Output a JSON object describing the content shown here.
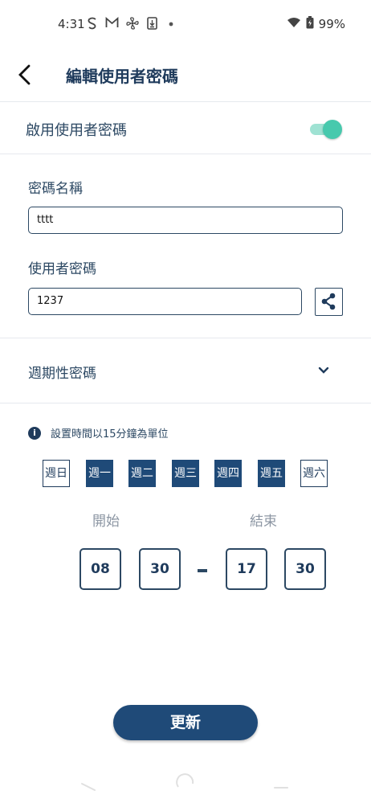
{
  "status_bar": {
    "time": "4:31",
    "battery": "99%",
    "icons": [
      "s-icon",
      "gmail-icon",
      "fan-icon",
      "download-icon",
      "dot-icon",
      "wifi-icon",
      "battery-icon"
    ]
  },
  "app_bar": {
    "title": "編輯使用者密碼",
    "back_icon": "chevron-left-icon"
  },
  "enable_row": {
    "label": "啟用使用者密碼",
    "enabled": true,
    "accent_color": "#47c9ad"
  },
  "password_name": {
    "label": "密碼名稱",
    "value": "tttt"
  },
  "user_password": {
    "label": "使用者密碼",
    "value": "1237",
    "share_icon": "share-icon"
  },
  "periodic": {
    "label": "週期性密碼",
    "icon": "chevron-down-icon"
  },
  "info": {
    "text": "設置時間以15分鐘為單位"
  },
  "days": [
    {
      "label": "週日",
      "selected": false
    },
    {
      "label": "週一",
      "selected": true
    },
    {
      "label": "週二",
      "selected": true
    },
    {
      "label": "週三",
      "selected": true
    },
    {
      "label": "週四",
      "selected": true
    },
    {
      "label": "週五",
      "selected": true
    },
    {
      "label": "週六",
      "selected": false
    }
  ],
  "schedule": {
    "start_label": "開始",
    "end_label": "結束",
    "start_hour": "08",
    "start_minute": "30",
    "end_hour": "17",
    "end_minute": "30"
  },
  "update_button": {
    "label": "更新"
  },
  "colors": {
    "primary": "#1f4a78",
    "text": "#2c4863",
    "muted": "#8c96a3"
  }
}
